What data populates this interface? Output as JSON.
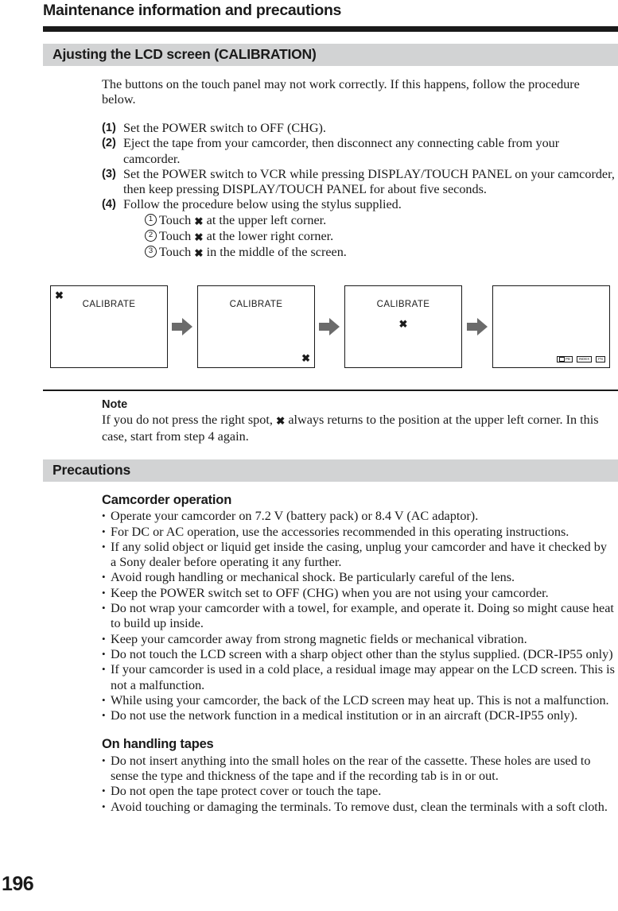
{
  "page": {
    "title": "Maintenance information and precautions",
    "folio": "196"
  },
  "calibration": {
    "section_title": "Ajusting the LCD screen (CALIBRATION)",
    "intro": "The buttons on the touch panel may not work correctly. If this happens, follow the procedure below.",
    "steps": [
      {
        "num": "(1)",
        "text": "Set the POWER switch to OFF (CHG)."
      },
      {
        "num": "(2)",
        "text": "Eject the tape from your camcorder, then disconnect any connecting cable from your camcorder."
      },
      {
        "num": "(3)",
        "text": "Set the POWER switch to VCR while pressing DISPLAY/TOUCH PANEL on your camcorder, then keep pressing DISPLAY/TOUCH PANEL for about five seconds."
      },
      {
        "num": "(4)",
        "text": "Follow the procedure below using the stylus supplied."
      }
    ],
    "substeps": [
      {
        "num": "1",
        "prefix": "Touch",
        "mark": "✖",
        "suffix": "at the upper left corner."
      },
      {
        "num": "2",
        "prefix": "Touch",
        "mark": "✖",
        "suffix": "at the lower right corner."
      },
      {
        "num": "3",
        "prefix": "Touch",
        "mark": "✖",
        "suffix": "in the middle of the screen."
      }
    ],
    "diagram": {
      "mark": "✖",
      "panels": [
        {
          "label": "CALIBRATE",
          "mark_position": "upper-left"
        },
        {
          "label": "CALIBRATE",
          "mark_position": "lower-right"
        },
        {
          "label": "CALIBRATE",
          "mark_position": "middle"
        },
        {
          "label": "",
          "mark_position": "none"
        }
      ],
      "panel4_buttons": [
        "PB",
        "INDEX",
        "FN"
      ]
    },
    "note": {
      "heading": "Note",
      "text_before": "If you do not press the right spot,",
      "mark": "✖",
      "text_after": "always returns to the position at the upper left corner. In this case, start from step 4 again."
    }
  },
  "precautions": {
    "section_title": "Precautions",
    "groups": [
      {
        "heading": "Camcorder operation",
        "bullets": [
          "Operate your camcorder on 7.2 V (battery pack) or 8.4 V (AC adaptor).",
          "For DC or AC operation, use the accessories recommended in this operating instructions.",
          "If any solid object or liquid get inside the casing, unplug your camcorder and have it checked by a Sony dealer before operating it any further.",
          "Avoid rough handling or mechanical shock. Be particularly careful of the lens.",
          "Keep the POWER switch set to OFF (CHG) when you are not using your camcorder.",
          "Do not wrap your camcorder with a towel, for example, and operate it. Doing so might cause heat to build up inside.",
          "Keep your camcorder away from strong magnetic fields or mechanical vibration.",
          "Do not touch the LCD screen with a sharp object other than the stylus supplied. (DCR-IP55 only)",
          "If your camcorder is used in a cold place, a residual image may appear on the LCD screen. This is not a malfunction.",
          "While using your camcorder, the back of the LCD screen may heat up. This is not a malfunction.",
          "Do not use the network function in a medical institution or in an aircraft (DCR-IP55 only)."
        ]
      },
      {
        "heading": "On handling tapes",
        "bullets": [
          "Do not insert anything into the small holes on the rear of the cassette. These holes are used to sense the type and thickness of the tape and if the recording tab is in or out.",
          "Do not open the tape protect cover or touch the tape.",
          "Avoid touching or damaging the terminals. To remove dust, clean the terminals with a soft cloth."
        ]
      }
    ]
  },
  "colors": {
    "ink": "#1a1a1a",
    "section_bar": "#d2d3d4",
    "arrow": "#6b6b6b"
  }
}
